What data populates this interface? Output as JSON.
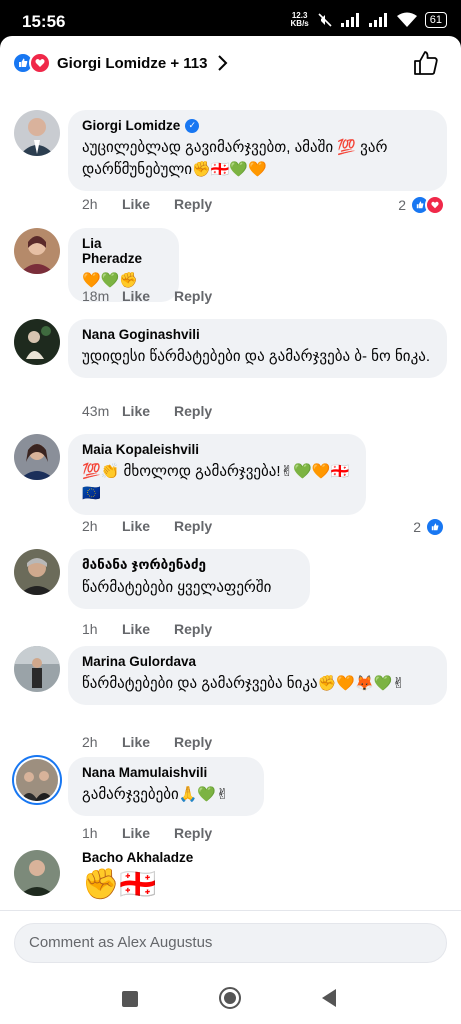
{
  "status": {
    "time": "15:56",
    "net_value": "12.3",
    "net_unit": "KB/s",
    "battery": "61"
  },
  "header": {
    "reactors": "Giorgi Lomidze + 113"
  },
  "comments": [
    {
      "author": "Giorgi Lomidze",
      "text": "აუცილებლად გავიმარჯვებთ, ამაში 💯 ვარ დარწმუნებული✊🇬🇪💚🧡",
      "time": "2h",
      "like": "Like",
      "reply": "Reply",
      "reaction_count": "2"
    },
    {
      "author": "Lia Pheradze",
      "text": "🧡💚✊",
      "time": "18m",
      "like": "Like",
      "reply": "Reply"
    },
    {
      "author": "Nana Goginashvili",
      "text": "უდიდესი წარმატებები და გამარჯვება ბ- ნო ნიკა.",
      "time": "43m",
      "like": "Like",
      "reply": "Reply"
    },
    {
      "author": "Maia Kopaleishvili",
      "text": "💯👏 მხოლოდ გამარჯვება!✌💚🧡🇬🇪🇪🇺",
      "time": "2h",
      "like": "Like",
      "reply": "Reply",
      "reaction_count": "2"
    },
    {
      "author": "მანანა ჯორბენაძე",
      "text": "წარმატებები ყველაფერში",
      "time": "1h",
      "like": "Like",
      "reply": "Reply"
    },
    {
      "author": "Marina Gulordava",
      "text": "წარმატებები და გამარჯვება ნიკა✊🧡🦊💚✌",
      "time": "2h",
      "like": "Like",
      "reply": "Reply"
    },
    {
      "author": "Nana Mamulaishvili",
      "text": "გამარჯვებები🙏💚✌",
      "time": "1h",
      "like": "Like",
      "reply": "Reply"
    },
    {
      "author": "Bacho Akhaladze",
      "text": "✊🇬🇪"
    }
  ],
  "composer": {
    "placeholder": "Comment as Alex Augustus"
  },
  "colors": {
    "accent": "#1877f2",
    "love": "#f02849",
    "bubble": "#f0f2f5",
    "muted": "#65676b"
  },
  "icons": [
    "like-reaction-icon",
    "love-reaction-icon",
    "chevron-right-icon",
    "thumbs-up-icon",
    "verified-badge-icon",
    "recents-icon",
    "home-icon",
    "back-icon"
  ]
}
